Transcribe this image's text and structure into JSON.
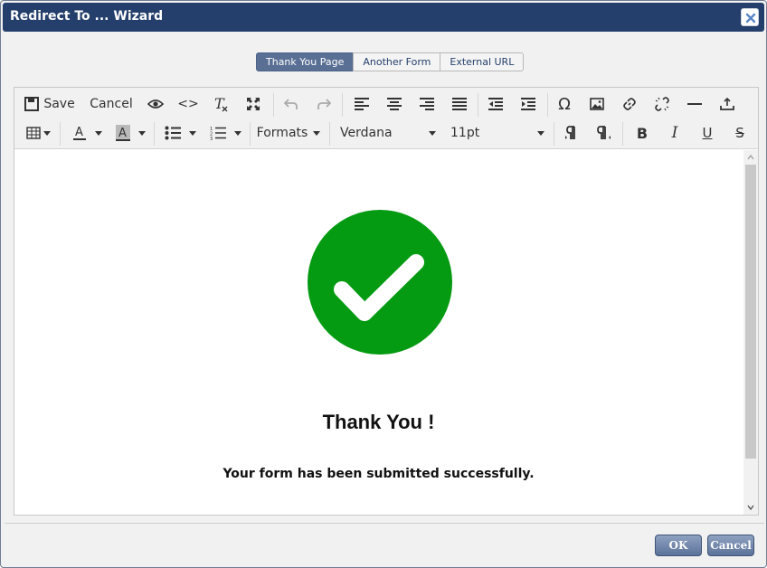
{
  "window": {
    "title": "Redirect To ... Wizard",
    "close_icon": "close-icon"
  },
  "tabs": [
    {
      "label": "Thank You Page",
      "active": true
    },
    {
      "label": "Another Form",
      "active": false
    },
    {
      "label": "External URL",
      "active": false
    }
  ],
  "toolbar": {
    "save_label": "Save",
    "cancel_label": "Cancel",
    "formats_label": "Formats",
    "font_family": "Verdana",
    "font_size": "11pt"
  },
  "content": {
    "heading": "Thank You !",
    "message": "Your form has been submitted successfully.",
    "check_color": "#049a12"
  },
  "footer": {
    "ok_label": "OK",
    "cancel_label": "Cancel"
  }
}
